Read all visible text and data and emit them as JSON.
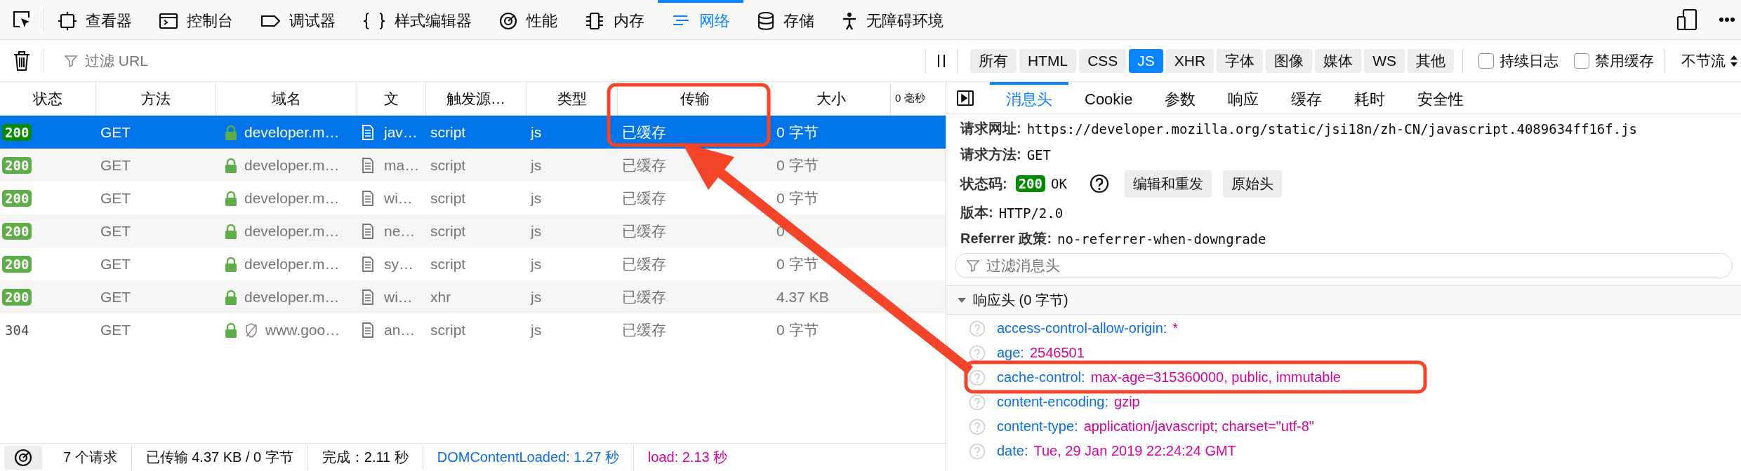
{
  "devtools_tabs": [
    {
      "label": "查看器",
      "selected": false
    },
    {
      "label": "控制台",
      "selected": false
    },
    {
      "label": "调试器",
      "selected": false
    },
    {
      "label": "样式编辑器",
      "selected": false
    },
    {
      "label": "性能",
      "selected": false
    },
    {
      "label": "内存",
      "selected": false
    },
    {
      "label": "网络",
      "selected": true
    },
    {
      "label": "存储",
      "selected": false
    },
    {
      "label": "无障碍环境",
      "selected": false
    }
  ],
  "toolbar": {
    "filter": {
      "placeholder": "过滤 URL"
    },
    "type_filters": [
      {
        "label": "所有",
        "selected": false
      },
      {
        "label": "HTML",
        "selected": false
      },
      {
        "label": "CSS",
        "selected": false
      },
      {
        "label": "JS",
        "selected": true
      },
      {
        "label": "XHR",
        "selected": false
      },
      {
        "label": "字体",
        "selected": false
      },
      {
        "label": "图像",
        "selected": false
      },
      {
        "label": "媒体",
        "selected": false
      },
      {
        "label": "WS",
        "selected": false
      },
      {
        "label": "其他",
        "selected": false
      }
    ],
    "options": [
      {
        "label": "持续日志",
        "checked": false
      },
      {
        "label": "禁用缓存",
        "checked": false
      }
    ],
    "throttling": "不节流"
  },
  "table": {
    "columns": [
      "状态",
      "方法",
      "域名",
      "文",
      "触发源…",
      "类型",
      "传输",
      "大小",
      "0 毫秒"
    ],
    "rows": [
      {
        "status": "200",
        "badge": true,
        "selected": true,
        "method": "GET",
        "secure": true,
        "tracker": false,
        "domain": "developer.m…",
        "file": "jav…",
        "cause": "script",
        "type": "js",
        "transferred": "已缓存",
        "size": "0 字节"
      },
      {
        "status": "200",
        "badge": true,
        "selected": false,
        "method": "GET",
        "secure": true,
        "tracker": false,
        "domain": "developer.m…",
        "file": "ma…",
        "cause": "script",
        "type": "js",
        "transferred": "已缓存",
        "size": "0 字节"
      },
      {
        "status": "200",
        "badge": true,
        "selected": false,
        "method": "GET",
        "secure": true,
        "tracker": false,
        "domain": "developer.m…",
        "file": "wi…",
        "cause": "script",
        "type": "js",
        "transferred": "已缓存",
        "size": "0 字节"
      },
      {
        "status": "200",
        "badge": true,
        "selected": false,
        "method": "GET",
        "secure": true,
        "tracker": false,
        "domain": "developer.m…",
        "file": "ne…",
        "cause": "script",
        "type": "js",
        "transferred": "已缓存",
        "size": "0"
      },
      {
        "status": "200",
        "badge": true,
        "selected": false,
        "method": "GET",
        "secure": true,
        "tracker": false,
        "domain": "developer.m…",
        "file": "sy…",
        "cause": "script",
        "type": "js",
        "transferred": "已缓存",
        "size": "0 字节"
      },
      {
        "status": "200",
        "badge": true,
        "selected": false,
        "method": "GET",
        "secure": true,
        "tracker": false,
        "domain": "developer.m…",
        "file": "wi…",
        "cause": "xhr",
        "type": "js",
        "transferred": "已缓存",
        "size": "4.37 KB"
      },
      {
        "status": "304",
        "badge": false,
        "selected": false,
        "method": "GET",
        "secure": true,
        "tracker": true,
        "domain": "www.goo…",
        "file": "an…",
        "cause": "script",
        "type": "js",
        "transferred": "已缓存",
        "size": "0 字节"
      }
    ]
  },
  "status_bar": {
    "items": [
      {
        "text": "7 个请求",
        "color": "#0c0c0d"
      },
      {
        "text": "已传输 4.37 KB / 0 字节",
        "color": "#0c0c0d"
      },
      {
        "text": "完成：2.11 秒",
        "color": "#0c0c0d"
      },
      {
        "text": "DOMContentLoaded: 1.27 秒",
        "color": "#0a6ee0"
      },
      {
        "text": "load: 2.13 秒",
        "color": "#d6009f"
      }
    ]
  },
  "details": {
    "tabs": [
      {
        "label": "消息头",
        "selected": true
      },
      {
        "label": "Cookie",
        "selected": false
      },
      {
        "label": "参数",
        "selected": false
      },
      {
        "label": "响应",
        "selected": false
      },
      {
        "label": "缓存",
        "selected": false
      },
      {
        "label": "耗时",
        "selected": false
      },
      {
        "label": "安全性",
        "selected": false
      }
    ],
    "summary": [
      {
        "kind": "text",
        "label": "请求网址:",
        "value": "https://developer.mozilla.org/static/jsi18n/zh-CN/javascript.4089634ff16f.js"
      },
      {
        "kind": "text",
        "label": "请求方法:",
        "value": "GET"
      },
      {
        "kind": "status",
        "label": "状态码:",
        "code": "200",
        "value": "OK",
        "buttons": [
          "编辑和重发",
          "原始头"
        ]
      },
      {
        "kind": "text",
        "label": "版本:",
        "value": "HTTP/2.0"
      },
      {
        "kind": "text",
        "label": "Referrer 政策:",
        "value": "no-referrer-when-downgrade"
      }
    ],
    "filter": {
      "placeholder": "过滤消息头"
    },
    "response_headers": {
      "title": "响应头 (0 字节)",
      "expanded": true,
      "headers": [
        {
          "name": "access-control-allow-origin:",
          "value": "*"
        },
        {
          "name": "age:",
          "value": "2546501"
        },
        {
          "name": "cache-control:",
          "value": "max-age=315360000, public, immutable"
        },
        {
          "name": "content-encoding:",
          "value": "gzip"
        },
        {
          "name": "content-type:",
          "value": "application/javascript; charset=\"utf-8\""
        },
        {
          "name": "date:",
          "value": "Tue, 29 Jan 2019 22:24:24 GMT"
        }
      ]
    }
  }
}
